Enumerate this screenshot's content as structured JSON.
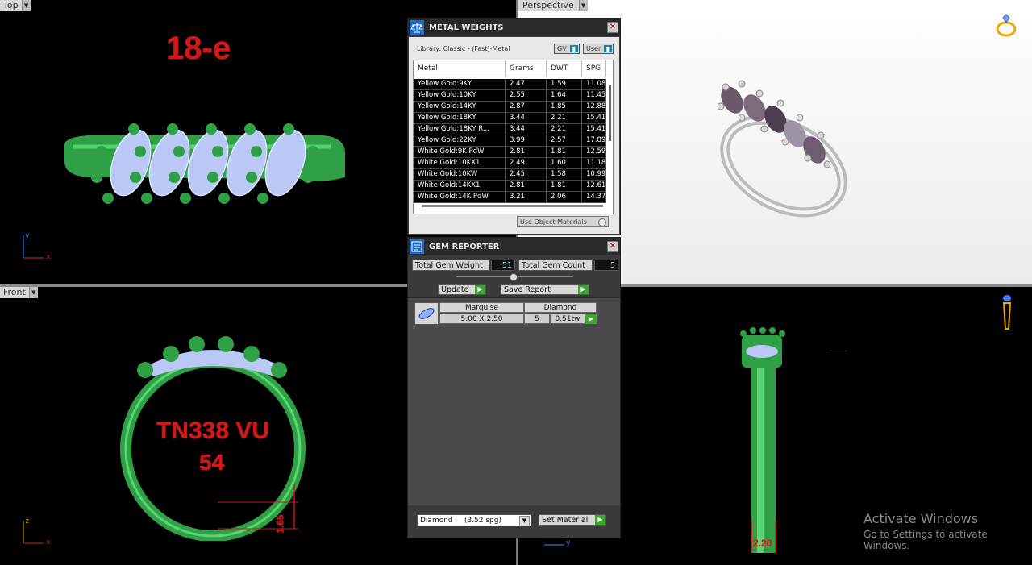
{
  "viewports": {
    "top": {
      "label": "Top",
      "annotation": "18-e",
      "axis_x": "x",
      "axis_y": "y"
    },
    "perspective": {
      "label": "Perspective"
    },
    "front": {
      "label": "Front",
      "annotation_line1": "TN338 VU",
      "annotation_line2": "54",
      "dimension": "1.65",
      "axis_x": "x",
      "axis_z": "z"
    },
    "right": {
      "dimension": "2.20",
      "axis_y": "y"
    }
  },
  "metal_weights": {
    "title": "METAL WEIGHTS",
    "library": "Library: Classic - (Fast)-Metal",
    "toggle_gv": "GV",
    "toggle_user": "User",
    "columns": [
      "Metal",
      "Grams",
      "DWT",
      "SPG"
    ],
    "rows": [
      [
        "Yellow Gold:9KY",
        "2.47",
        "1.59",
        "11.08"
      ],
      [
        "Yellow Gold:10KY",
        "2.55",
        "1.64",
        "11.45"
      ],
      [
        "Yellow Gold:14KY",
        "2.87",
        "1.85",
        "12.88"
      ],
      [
        "Yellow Gold:18KY",
        "3.44",
        "2.21",
        "15.41"
      ],
      [
        "Yellow Gold:18KY R...",
        "3.44",
        "2.21",
        "15.41"
      ],
      [
        "Yellow Gold:22KY",
        "3.99",
        "2.57",
        "17.89"
      ],
      [
        "White Gold:9K PdW",
        "2.81",
        "1.81",
        "12.59"
      ],
      [
        "White Gold:10KX1",
        "2.49",
        "1.60",
        "11.18"
      ],
      [
        "White Gold:10KW",
        "2.45",
        "1.58",
        "10.99"
      ],
      [
        "White Gold:14KX1",
        "2.81",
        "1.81",
        "12.61"
      ],
      [
        "White Gold:14K PdW",
        "3.21",
        "2.06",
        "14.37"
      ]
    ],
    "use_object_materials": "Use Object Materials"
  },
  "gem_reporter": {
    "title": "GEM REPORTER",
    "total_gem_weight_label": "Total Gem Weight",
    "total_gem_weight": ".51",
    "total_gem_count_label": "Total Gem Count",
    "total_gem_count": "5",
    "update_label": "Update",
    "save_report_label": "Save Report",
    "gem": {
      "cut": "Marquise",
      "material": "Diamond",
      "size": "5.00 X 2.50",
      "count": "5",
      "weight": "0.51tw"
    },
    "material_select": "Diamond     (3.52 spg)",
    "set_material_label": "Set Material"
  },
  "watermark": {
    "line1": "Activate Windows",
    "line2": "Go to Settings to activate Windows."
  },
  "colors": {
    "ring_green": "#2fa046",
    "gem_blue": "#b9c8f5",
    "annotation_red": "#d01818",
    "perspective_bg": "#ffffff"
  }
}
